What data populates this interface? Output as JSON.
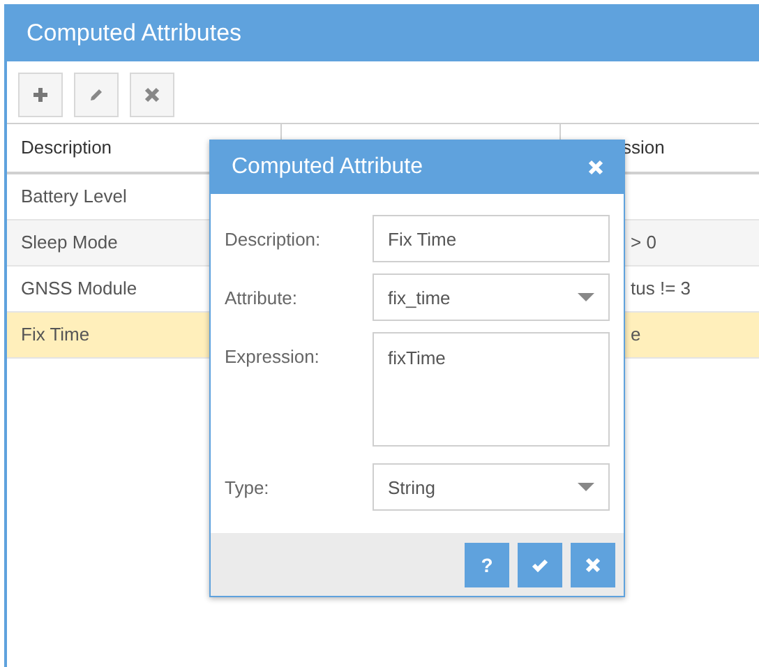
{
  "window": {
    "title": "Computed Attributes"
  },
  "toolbar": [
    {
      "kind": "add"
    },
    {
      "kind": "edit"
    },
    {
      "kind": "remove"
    }
  ],
  "table": {
    "columns": [
      "Description",
      "",
      "ssion"
    ],
    "rows": [
      {
        "cells": [
          "Battery Level",
          ""
        ],
        "selected": false
      },
      {
        "cells": [
          "Sleep Mode",
          "> 0"
        ],
        "selected": false
      },
      {
        "cells": [
          "GNSS Module",
          "tus != 3"
        ],
        "selected": false
      },
      {
        "cells": [
          "Fix Time",
          "e"
        ],
        "selected": true
      }
    ]
  },
  "dialog": {
    "title": "Computed Attribute",
    "fields": [
      {
        "kind": "text",
        "label": "Description:",
        "value": "Fix Time"
      },
      {
        "kind": "select",
        "label": "Attribute:",
        "value": "fix_time"
      },
      {
        "kind": "textarea",
        "label": "Expression:",
        "value": "fixTime"
      },
      {
        "kind": "select",
        "label": "Type:",
        "value": "String"
      }
    ],
    "buttons": [
      {
        "kind": "help",
        "text": "?"
      },
      {
        "kind": "save"
      },
      {
        "kind": "cancel"
      }
    ]
  }
}
